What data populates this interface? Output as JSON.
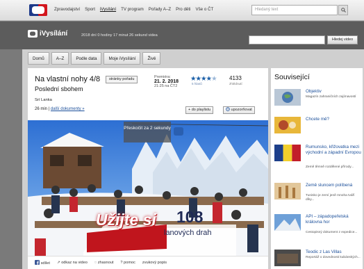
{
  "topbar": {
    "nav": [
      "Zpravodajství",
      "Sport",
      "iVysílání",
      "TV program",
      "Pořady A–Z",
      "Pro děti",
      "Vše o ČT"
    ],
    "active": "iVysílání",
    "search_placeholder": "Hledaný text"
  },
  "header": {
    "brand": "iVysílání",
    "status": "2018 dní 0 hodiny 17 minut 26 sekund videa",
    "search_button": "Hledej video"
  },
  "subnav": [
    "Domů",
    "A–Z",
    "Podle data",
    "Moje iVysílání",
    "Živě"
  ],
  "episode": {
    "title": "Na vlastní nohy 4/8",
    "subtitle": "Poslední sbohem",
    "pages_button": "stránky pořadu",
    "premiere_label": "Premiéra:",
    "premiere_date": "21. 2. 2018",
    "premiere_time": "21:25 na ČT2",
    "rating": 4.5,
    "rating_stars": "★★★★",
    "rating_half": "★",
    "votes": "5 hlasů",
    "views": "4133",
    "views_label": "zhlédnutí",
    "country": "Srí Lanka",
    "duration": "26 min",
    "more_docs": "další dokumenty »",
    "add_playlist": "+ do playlistu",
    "reminder": "upozorňovat"
  },
  "video": {
    "skip": "Přeskočit za 2 sekundy",
    "ad_headline": "Užijte si",
    "ad_number": "108",
    "ad_sub": "lanových drah"
  },
  "actions": [
    "sdílet",
    "odkaz na video",
    "zhasnout",
    "pomoc",
    "zvukový popis"
  ],
  "related": {
    "heading": "Související",
    "items": [
      {
        "title": "Objektiv",
        "desc": "Magazín zahraničních zajímavostí"
      },
      {
        "title": "Chcete mě?",
        "desc": ""
      },
      {
        "title": "Rumunsko, křižovatka mezi východní a západní Evropou",
        "desc": "Země těmně rozdělené přírody..."
      },
      {
        "title": "Země sluncem políbená",
        "desc": "Tunisko je zemí jeně mnoha tváří díky..."
      },
      {
        "title": "API – západopeřelská královna hor",
        "desc": "Cestopisný dokument z expedice..."
      },
      {
        "title": "Teodic z Las Villas",
        "desc": "Reportáž o dovednosti kubánských..."
      }
    ]
  },
  "colors": {
    "accent": "#1b4f9a",
    "brand_red": "#c0151d",
    "header_dark": "#5c5c5c"
  }
}
